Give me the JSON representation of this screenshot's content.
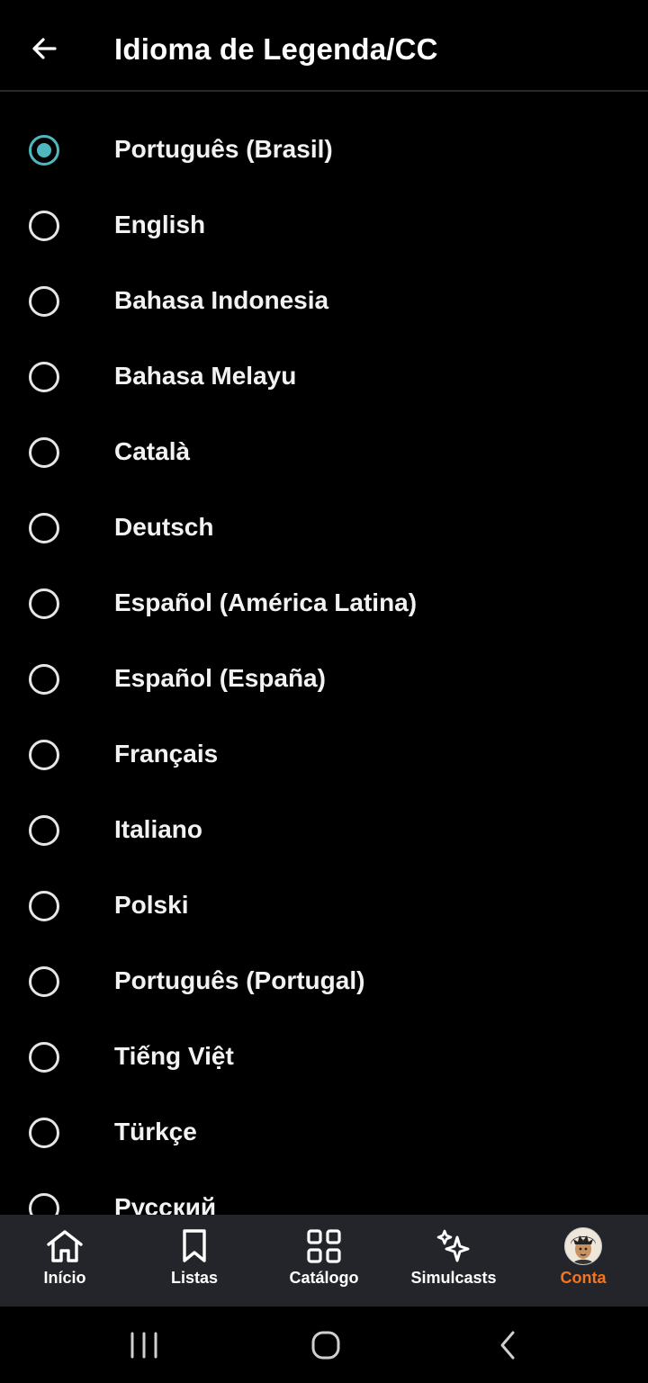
{
  "header": {
    "title": "Idioma de Legenda/CC",
    "back_icon": "arrow-left-icon"
  },
  "options": [
    {
      "label": "Português (Brasil)",
      "selected": true
    },
    {
      "label": "English",
      "selected": false
    },
    {
      "label": "Bahasa Indonesia",
      "selected": false
    },
    {
      "label": "Bahasa Melayu",
      "selected": false
    },
    {
      "label": "Català",
      "selected": false
    },
    {
      "label": "Deutsch",
      "selected": false
    },
    {
      "label": "Español (América Latina)",
      "selected": false
    },
    {
      "label": "Español (España)",
      "selected": false
    },
    {
      "label": "Français",
      "selected": false
    },
    {
      "label": "Italiano",
      "selected": false
    },
    {
      "label": "Polski",
      "selected": false
    },
    {
      "label": "Português (Portugal)",
      "selected": false
    },
    {
      "label": "Tiếng Việt",
      "selected": false
    },
    {
      "label": "Türkçe",
      "selected": false
    },
    {
      "label": "Русский",
      "selected": false
    }
  ],
  "tabbar": {
    "tabs": [
      {
        "label": "Início",
        "icon": "home-icon",
        "active": false
      },
      {
        "label": "Listas",
        "icon": "bookmark-icon",
        "active": false
      },
      {
        "label": "Catálogo",
        "icon": "grid-icon",
        "active": false
      },
      {
        "label": "Simulcasts",
        "icon": "sparkles-icon",
        "active": false
      },
      {
        "label": "Conta",
        "icon": "avatar",
        "active": true
      }
    ]
  },
  "colors": {
    "background": "#000000",
    "radio_selected": "#4fb8bf",
    "tab_active": "#f47521",
    "tabbar_background": "#23252b"
  },
  "system_nav": {
    "icons": [
      "recent-apps-icon",
      "home-circle-icon",
      "back-chevron-icon"
    ]
  }
}
